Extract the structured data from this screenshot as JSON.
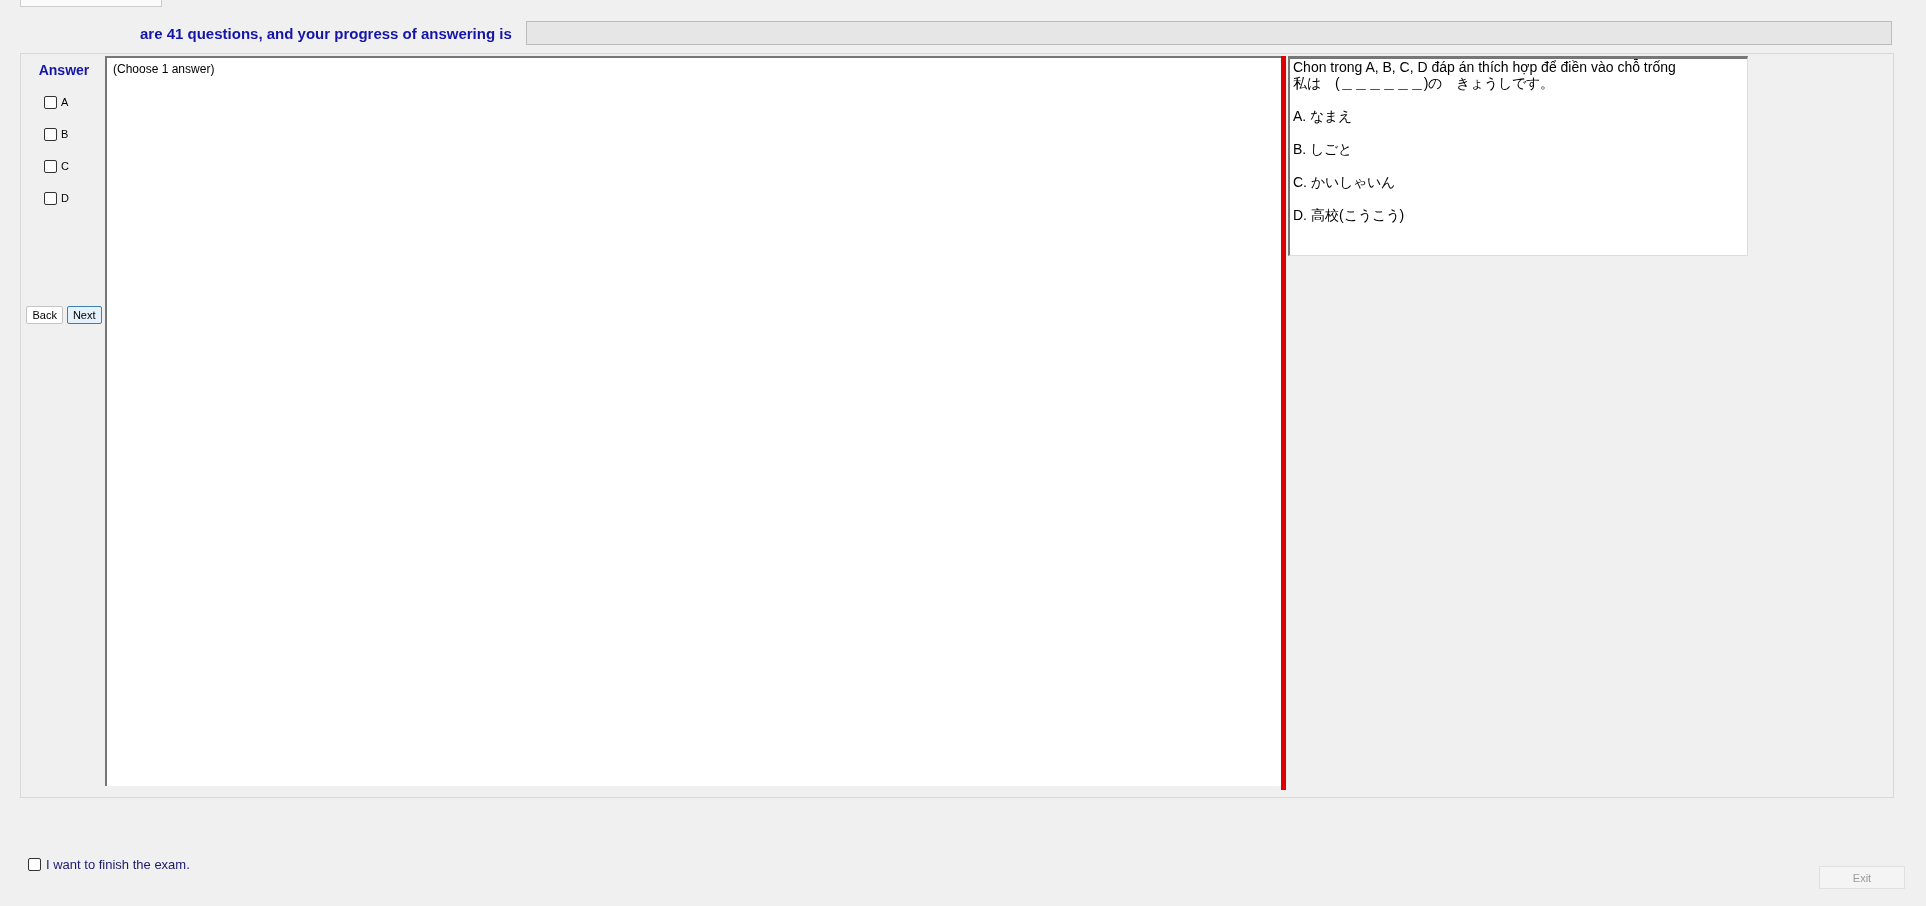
{
  "header": {
    "progress_text": "are 41 questions, and your progress of answering is",
    "progress": {
      "level": 0
    }
  },
  "answer_panel": {
    "title": "Answer",
    "options": [
      {
        "label": "A",
        "checked": false
      },
      {
        "label": "B",
        "checked": false
      },
      {
        "label": "C",
        "checked": false
      },
      {
        "label": "D",
        "checked": false
      }
    ],
    "buttons": [
      {
        "label": "Back",
        "selected": false
      },
      {
        "label": "Next",
        "selected": true
      }
    ]
  },
  "question_area": {
    "instruction": "(Choose 1 answer)"
  },
  "question_panel": {
    "lines": [
      "Chon trong A, B, C, D đáp án thích hợp để điền vào chỗ trống",
      "私は　(＿＿＿＿＿＿)の　きょうしです。"
    ],
    "choices": [
      "A.  なまえ",
      "B.  しごと",
      "C.  かいしゃいん",
      "D.  高校(こうこう)"
    ]
  },
  "footer": {
    "finish_checkbox": {
      "label": "I want to finish the exam.",
      "checked": false
    },
    "exit_button": {
      "label": "Exit",
      "disabled": true
    }
  }
}
